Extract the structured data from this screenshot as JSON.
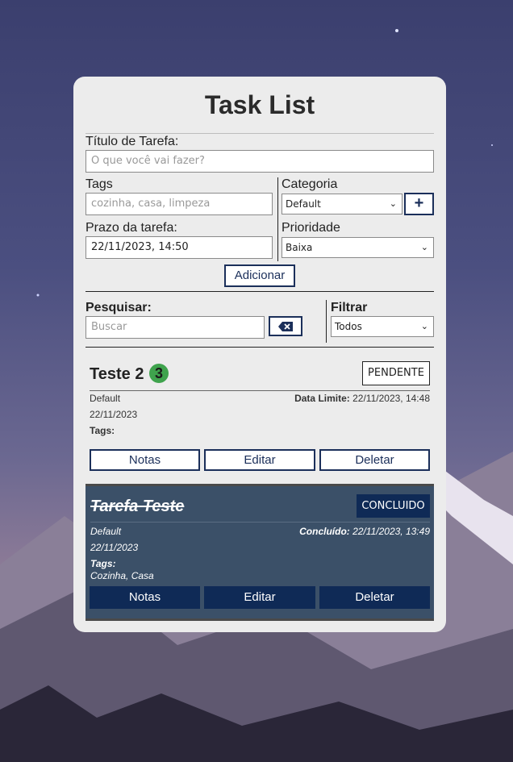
{
  "app": {
    "title": "Task List"
  },
  "form": {
    "title_label": "Título de Tarefa:",
    "title_placeholder": "O que você vai fazer?",
    "tags_label": "Tags",
    "tags_placeholder": "cozinha, casa, limpeza",
    "category_label": "Categoria",
    "category_value": "Default",
    "add_category_symbol": "+",
    "deadline_label": "Prazo da tarefa:",
    "deadline_value": "22/11/2023, 14:50",
    "priority_label": "Prioridade",
    "priority_value": "Baixa",
    "add_button": "Adicionar"
  },
  "search": {
    "label": "Pesquisar:",
    "placeholder": "Buscar",
    "filter_label": "Filtrar",
    "filter_value": "Todos"
  },
  "tasks": [
    {
      "title": "Teste 2",
      "badge": "3",
      "status": "PENDENTE",
      "category": "Default",
      "date": "22/11/2023",
      "deadline_label": "Data Limite:",
      "deadline_value": "22/11/2023, 14:48",
      "tags_label": "Tags:",
      "tags_value": "",
      "buttons": {
        "notes": "Notas",
        "edit": "Editar",
        "delete": "Deletar"
      }
    },
    {
      "title": "Tarefa Teste",
      "status": "CONCLUIDO",
      "category": "Default",
      "date": "22/11/2023",
      "deadline_label": "Concluído:",
      "deadline_value": "22/11/2023, 13:49",
      "tags_label": "Tags:",
      "tags_value": "Cozinha, Casa",
      "buttons": {
        "notes": "Notas",
        "edit": "Editar",
        "delete": "Deletar"
      }
    }
  ],
  "colors": {
    "accent": "#1b2f5a",
    "navy_button": "#0f2a56",
    "completed_card": "#3b5068",
    "badge": "#3fa34d"
  },
  "icons": {
    "clear_search": "backspace-icon",
    "dropdown": "chevron-down-icon"
  }
}
